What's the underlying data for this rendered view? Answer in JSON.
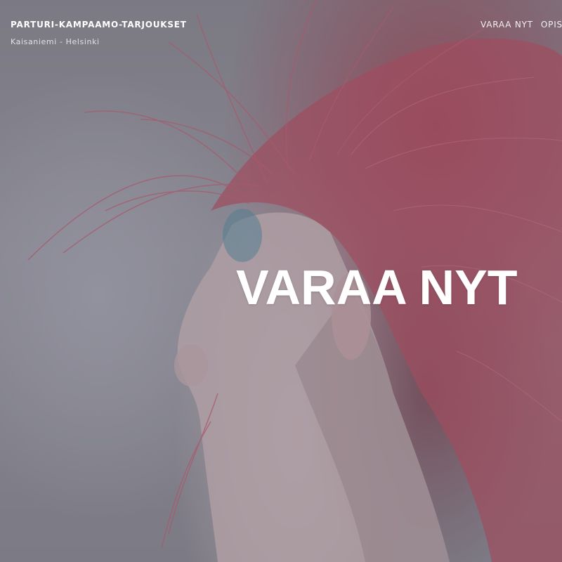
{
  "header": {
    "brand_title": "PARTURI-KAMPAAMO-TARJOUKSET",
    "brand_subtitle": "Kaisaniemi - Helsinki"
  },
  "nav": {
    "items": [
      {
        "label": "VARAA NYT"
      },
      {
        "label": "OPISK"
      }
    ]
  },
  "hero": {
    "cta_label": "VARAA NYT",
    "image_icon": "portrait-pink-hair-photo"
  },
  "colors": {
    "text_white": "#ffffff",
    "hair_pink": "#c25a6c",
    "background_gray": "#9d9ba6"
  }
}
